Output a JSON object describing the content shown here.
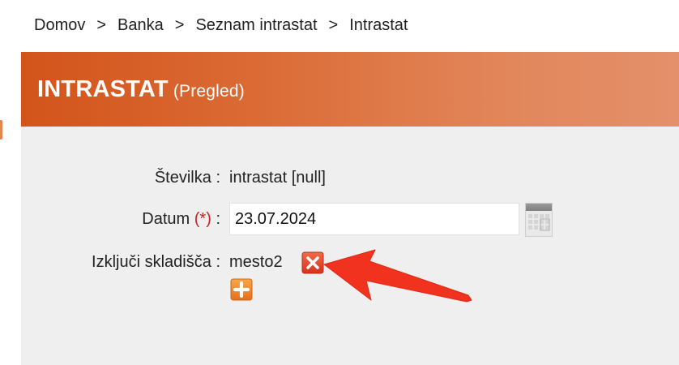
{
  "breadcrumb": {
    "items": [
      "Domov",
      "Banka",
      "Seznam intrastat",
      "Intrastat"
    ],
    "separator": ">"
  },
  "header": {
    "title": "INTRASTAT",
    "subtitle": "(Pregled)"
  },
  "form": {
    "stevilka": {
      "label": "Številka",
      "colon": ":",
      "value": "intrastat [null]"
    },
    "datum": {
      "label": "Datum",
      "required_mark": "(*)",
      "colon": ":",
      "value": "23.07.2024"
    },
    "skladisca": {
      "label": "Izključi skladišča",
      "colon": ":",
      "items": [
        "mesto2"
      ]
    }
  },
  "icons": {
    "calendar": "calendar-icon",
    "remove": "remove-icon",
    "add": "add-icon",
    "annotation": "annotation-arrow"
  },
  "colors": {
    "header_start": "#d2541a",
    "header_end": "#e4906a",
    "panel_bg": "#efefef",
    "required": "#cc2222",
    "arrow": "#f0321e",
    "remove_icon": "#e8452c",
    "add_icon": "#f08a2a"
  }
}
